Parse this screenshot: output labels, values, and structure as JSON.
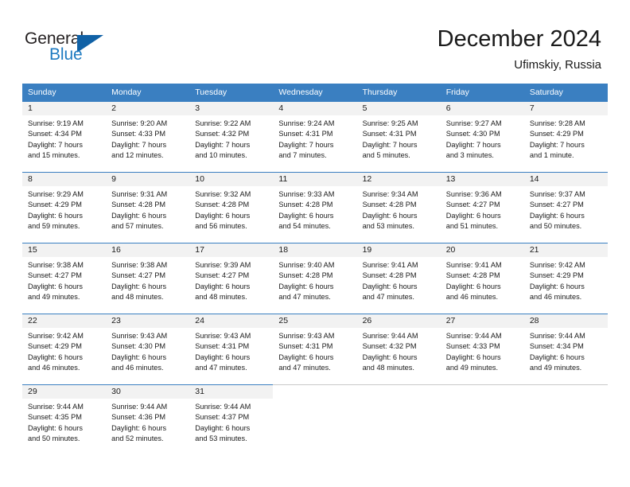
{
  "logo": {
    "word_top": "General",
    "word_bottom": "Blue",
    "accent_color": "#1061a6",
    "blue_text_color": "#1f7bc1"
  },
  "header": {
    "title": "December 2024",
    "subtitle": "Ufimskiy, Russia"
  },
  "theme": {
    "header_blue": "#3a7fc1",
    "daynum_band": "#f2f2f2",
    "grid_line": "#c8c8c8",
    "text": "#1a1a1a"
  },
  "weekday_headers": [
    "Sunday",
    "Monday",
    "Tuesday",
    "Wednesday",
    "Thursday",
    "Friday",
    "Saturday"
  ],
  "weeks": [
    [
      {
        "day": "1",
        "sunrise": "Sunrise: 9:19 AM",
        "sunset": "Sunset: 4:34 PM",
        "daylight1": "Daylight: 7 hours",
        "daylight2": "and 15 minutes."
      },
      {
        "day": "2",
        "sunrise": "Sunrise: 9:20 AM",
        "sunset": "Sunset: 4:33 PM",
        "daylight1": "Daylight: 7 hours",
        "daylight2": "and 12 minutes."
      },
      {
        "day": "3",
        "sunrise": "Sunrise: 9:22 AM",
        "sunset": "Sunset: 4:32 PM",
        "daylight1": "Daylight: 7 hours",
        "daylight2": "and 10 minutes."
      },
      {
        "day": "4",
        "sunrise": "Sunrise: 9:24 AM",
        "sunset": "Sunset: 4:31 PM",
        "daylight1": "Daylight: 7 hours",
        "daylight2": "and 7 minutes."
      },
      {
        "day": "5",
        "sunrise": "Sunrise: 9:25 AM",
        "sunset": "Sunset: 4:31 PM",
        "daylight1": "Daylight: 7 hours",
        "daylight2": "and 5 minutes."
      },
      {
        "day": "6",
        "sunrise": "Sunrise: 9:27 AM",
        "sunset": "Sunset: 4:30 PM",
        "daylight1": "Daylight: 7 hours",
        "daylight2": "and 3 minutes."
      },
      {
        "day": "7",
        "sunrise": "Sunrise: 9:28 AM",
        "sunset": "Sunset: 4:29 PM",
        "daylight1": "Daylight: 7 hours",
        "daylight2": "and 1 minute."
      }
    ],
    [
      {
        "day": "8",
        "sunrise": "Sunrise: 9:29 AM",
        "sunset": "Sunset: 4:29 PM",
        "daylight1": "Daylight: 6 hours",
        "daylight2": "and 59 minutes."
      },
      {
        "day": "9",
        "sunrise": "Sunrise: 9:31 AM",
        "sunset": "Sunset: 4:28 PM",
        "daylight1": "Daylight: 6 hours",
        "daylight2": "and 57 minutes."
      },
      {
        "day": "10",
        "sunrise": "Sunrise: 9:32 AM",
        "sunset": "Sunset: 4:28 PM",
        "daylight1": "Daylight: 6 hours",
        "daylight2": "and 56 minutes."
      },
      {
        "day": "11",
        "sunrise": "Sunrise: 9:33 AM",
        "sunset": "Sunset: 4:28 PM",
        "daylight1": "Daylight: 6 hours",
        "daylight2": "and 54 minutes."
      },
      {
        "day": "12",
        "sunrise": "Sunrise: 9:34 AM",
        "sunset": "Sunset: 4:28 PM",
        "daylight1": "Daylight: 6 hours",
        "daylight2": "and 53 minutes."
      },
      {
        "day": "13",
        "sunrise": "Sunrise: 9:36 AM",
        "sunset": "Sunset: 4:27 PM",
        "daylight1": "Daylight: 6 hours",
        "daylight2": "and 51 minutes."
      },
      {
        "day": "14",
        "sunrise": "Sunrise: 9:37 AM",
        "sunset": "Sunset: 4:27 PM",
        "daylight1": "Daylight: 6 hours",
        "daylight2": "and 50 minutes."
      }
    ],
    [
      {
        "day": "15",
        "sunrise": "Sunrise: 9:38 AM",
        "sunset": "Sunset: 4:27 PM",
        "daylight1": "Daylight: 6 hours",
        "daylight2": "and 49 minutes."
      },
      {
        "day": "16",
        "sunrise": "Sunrise: 9:38 AM",
        "sunset": "Sunset: 4:27 PM",
        "daylight1": "Daylight: 6 hours",
        "daylight2": "and 48 minutes."
      },
      {
        "day": "17",
        "sunrise": "Sunrise: 9:39 AM",
        "sunset": "Sunset: 4:27 PM",
        "daylight1": "Daylight: 6 hours",
        "daylight2": "and 48 minutes."
      },
      {
        "day": "18",
        "sunrise": "Sunrise: 9:40 AM",
        "sunset": "Sunset: 4:28 PM",
        "daylight1": "Daylight: 6 hours",
        "daylight2": "and 47 minutes."
      },
      {
        "day": "19",
        "sunrise": "Sunrise: 9:41 AM",
        "sunset": "Sunset: 4:28 PM",
        "daylight1": "Daylight: 6 hours",
        "daylight2": "and 47 minutes."
      },
      {
        "day": "20",
        "sunrise": "Sunrise: 9:41 AM",
        "sunset": "Sunset: 4:28 PM",
        "daylight1": "Daylight: 6 hours",
        "daylight2": "and 46 minutes."
      },
      {
        "day": "21",
        "sunrise": "Sunrise: 9:42 AM",
        "sunset": "Sunset: 4:29 PM",
        "daylight1": "Daylight: 6 hours",
        "daylight2": "and 46 minutes."
      }
    ],
    [
      {
        "day": "22",
        "sunrise": "Sunrise: 9:42 AM",
        "sunset": "Sunset: 4:29 PM",
        "daylight1": "Daylight: 6 hours",
        "daylight2": "and 46 minutes."
      },
      {
        "day": "23",
        "sunrise": "Sunrise: 9:43 AM",
        "sunset": "Sunset: 4:30 PM",
        "daylight1": "Daylight: 6 hours",
        "daylight2": "and 46 minutes."
      },
      {
        "day": "24",
        "sunrise": "Sunrise: 9:43 AM",
        "sunset": "Sunset: 4:31 PM",
        "daylight1": "Daylight: 6 hours",
        "daylight2": "and 47 minutes."
      },
      {
        "day": "25",
        "sunrise": "Sunrise: 9:43 AM",
        "sunset": "Sunset: 4:31 PM",
        "daylight1": "Daylight: 6 hours",
        "daylight2": "and 47 minutes."
      },
      {
        "day": "26",
        "sunrise": "Sunrise: 9:44 AM",
        "sunset": "Sunset: 4:32 PM",
        "daylight1": "Daylight: 6 hours",
        "daylight2": "and 48 minutes."
      },
      {
        "day": "27",
        "sunrise": "Sunrise: 9:44 AM",
        "sunset": "Sunset: 4:33 PM",
        "daylight1": "Daylight: 6 hours",
        "daylight2": "and 49 minutes."
      },
      {
        "day": "28",
        "sunrise": "Sunrise: 9:44 AM",
        "sunset": "Sunset: 4:34 PM",
        "daylight1": "Daylight: 6 hours",
        "daylight2": "and 49 minutes."
      }
    ],
    [
      {
        "day": "29",
        "sunrise": "Sunrise: 9:44 AM",
        "sunset": "Sunset: 4:35 PM",
        "daylight1": "Daylight: 6 hours",
        "daylight2": "and 50 minutes."
      },
      {
        "day": "30",
        "sunrise": "Sunrise: 9:44 AM",
        "sunset": "Sunset: 4:36 PM",
        "daylight1": "Daylight: 6 hours",
        "daylight2": "and 52 minutes."
      },
      {
        "day": "31",
        "sunrise": "Sunrise: 9:44 AM",
        "sunset": "Sunset: 4:37 PM",
        "daylight1": "Daylight: 6 hours",
        "daylight2": "and 53 minutes."
      },
      {
        "day": "",
        "sunrise": "",
        "sunset": "",
        "daylight1": "",
        "daylight2": ""
      },
      {
        "day": "",
        "sunrise": "",
        "sunset": "",
        "daylight1": "",
        "daylight2": ""
      },
      {
        "day": "",
        "sunrise": "",
        "sunset": "",
        "daylight1": "",
        "daylight2": ""
      },
      {
        "day": "",
        "sunrise": "",
        "sunset": "",
        "daylight1": "",
        "daylight2": ""
      }
    ]
  ]
}
